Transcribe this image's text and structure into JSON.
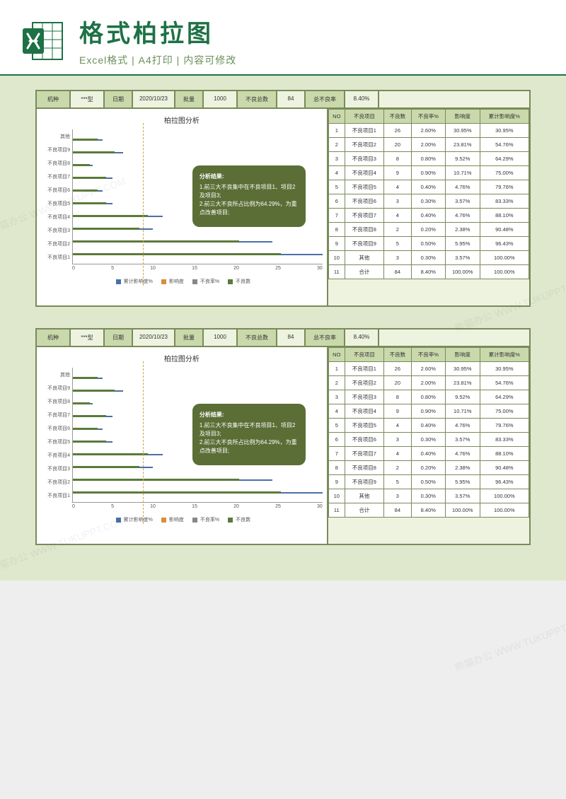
{
  "header": {
    "title": "格式柏拉图",
    "subtitle": "Excel格式 | A4打印 | 内容可修改"
  },
  "info": {
    "machine_label": "机种",
    "machine_val": "***型",
    "date_label": "日期",
    "date_val": "2020/10/23",
    "batch_label": "批量",
    "batch_val": "1000",
    "defect_total_label": "不良总数",
    "defect_total_val": "84",
    "defect_rate_label": "总不良率",
    "defect_rate_val": "8.40%"
  },
  "chart_data": {
    "type": "bar",
    "title": "柏拉图分析",
    "orientation": "horizontal",
    "categories": [
      "不良项目1",
      "不良项目2",
      "不良项目3",
      "不良项目4",
      "不良项目5",
      "不良项目6",
      "不良项目7",
      "不良项目8",
      "不良项目9",
      "其他"
    ],
    "series": [
      {
        "name": "不良数",
        "values": [
          26,
          20,
          8,
          9,
          4,
          3,
          4,
          2,
          5,
          3
        ]
      },
      {
        "name": "不良率%",
        "values": [
          2.6,
          2.0,
          0.8,
          0.9,
          0.4,
          0.3,
          0.4,
          0.2,
          0.5,
          0.3
        ]
      },
      {
        "name": "影响度",
        "values": [
          30.95,
          23.81,
          9.52,
          10.71,
          4.76,
          3.57,
          4.76,
          2.38,
          5.95,
          3.57
        ]
      },
      {
        "name": "累计影响度%",
        "values": [
          30.95,
          54.76,
          64.29,
          75.0,
          79.76,
          83.33,
          88.1,
          90.48,
          96.43,
          100.0
        ]
      }
    ],
    "xlabel": "",
    "ylabel": "",
    "xticks": [
      0,
      5,
      10,
      15,
      20,
      25,
      30
    ],
    "xlim": [
      0,
      30
    ],
    "annotation": {
      "title": "分析结果:",
      "line1": "1.前三大不良集中在不良项目1、项目2及项目3;",
      "line2": "2.前三大不良所占比例为64.29%，为重点改善项目;"
    },
    "legend": [
      "累计影响度%",
      "影响度",
      "不良率%",
      "不良数"
    ]
  },
  "table": {
    "headers": [
      "NO",
      "不良项目",
      "不良数",
      "不良率%",
      "影响度",
      "累计影响度%"
    ],
    "rows": [
      [
        "1",
        "不良项目1",
        "26",
        "2.60%",
        "30.95%",
        "30.95%"
      ],
      [
        "2",
        "不良项目2",
        "20",
        "2.00%",
        "23.81%",
        "54.76%"
      ],
      [
        "3",
        "不良项目3",
        "8",
        "0.80%",
        "9.52%",
        "64.29%"
      ],
      [
        "4",
        "不良项目4",
        "9",
        "0.90%",
        "10.71%",
        "75.00%"
      ],
      [
        "5",
        "不良项目5",
        "4",
        "0.40%",
        "4.76%",
        "79.76%"
      ],
      [
        "6",
        "不良项目6",
        "3",
        "0.30%",
        "3.57%",
        "83.33%"
      ],
      [
        "7",
        "不良项目7",
        "4",
        "0.40%",
        "4.76%",
        "88.10%"
      ],
      [
        "8",
        "不良项目8",
        "2",
        "0.20%",
        "2.38%",
        "90.48%"
      ],
      [
        "9",
        "不良项目9",
        "5",
        "0.50%",
        "5.95%",
        "96.43%"
      ],
      [
        "10",
        "其他",
        "3",
        "0.30%",
        "3.57%",
        "100.00%"
      ],
      [
        "11",
        "合计",
        "84",
        "8.40%",
        "100.00%",
        "100.00%"
      ]
    ]
  },
  "watermark": "熊猫办公 WWW.TUKUPPT.COM"
}
